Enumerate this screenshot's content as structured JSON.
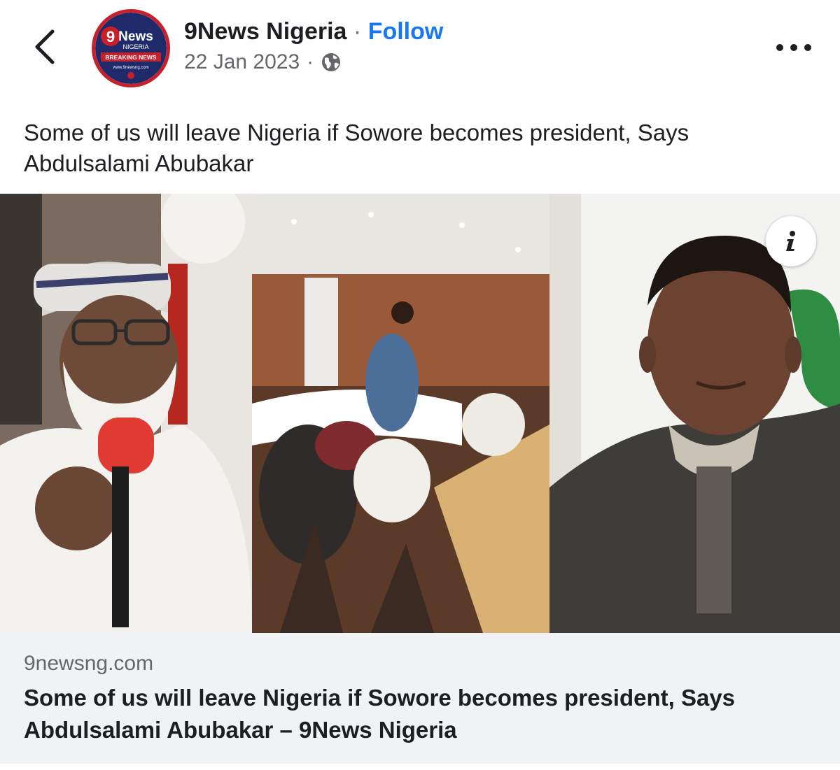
{
  "post": {
    "page_name": "9News Nigeria",
    "separator": "·",
    "follow_label": "Follow",
    "date": "22 Jan 2023",
    "meta_separator": "·",
    "privacy_icon": "globe-icon",
    "caption": "Some of us will leave Nigeria if Sowore becomes president, Says Abdulsalami Abubakar"
  },
  "avatar_logo": {
    "brand": "9News",
    "sub": "NIGERIA",
    "badge": "BREAKING NEWS",
    "url": "www.9newsng.com"
  },
  "link_preview": {
    "domain": "9newsng.com",
    "title": "Some of us will leave Nigeria if Sowore becomes president, Says Abdulsalami Abubakar – 9News Nigeria",
    "info_icon": "info-icon"
  },
  "icons": {
    "back": "chevron-left-icon",
    "more": "more-horizontal-icon"
  },
  "colors": {
    "follow": "#1877f2",
    "secondary_text": "#65676b",
    "card_background": "#f0f2f5",
    "brand_red": "#c8202b",
    "brand_navy": "#1f2a6b"
  }
}
